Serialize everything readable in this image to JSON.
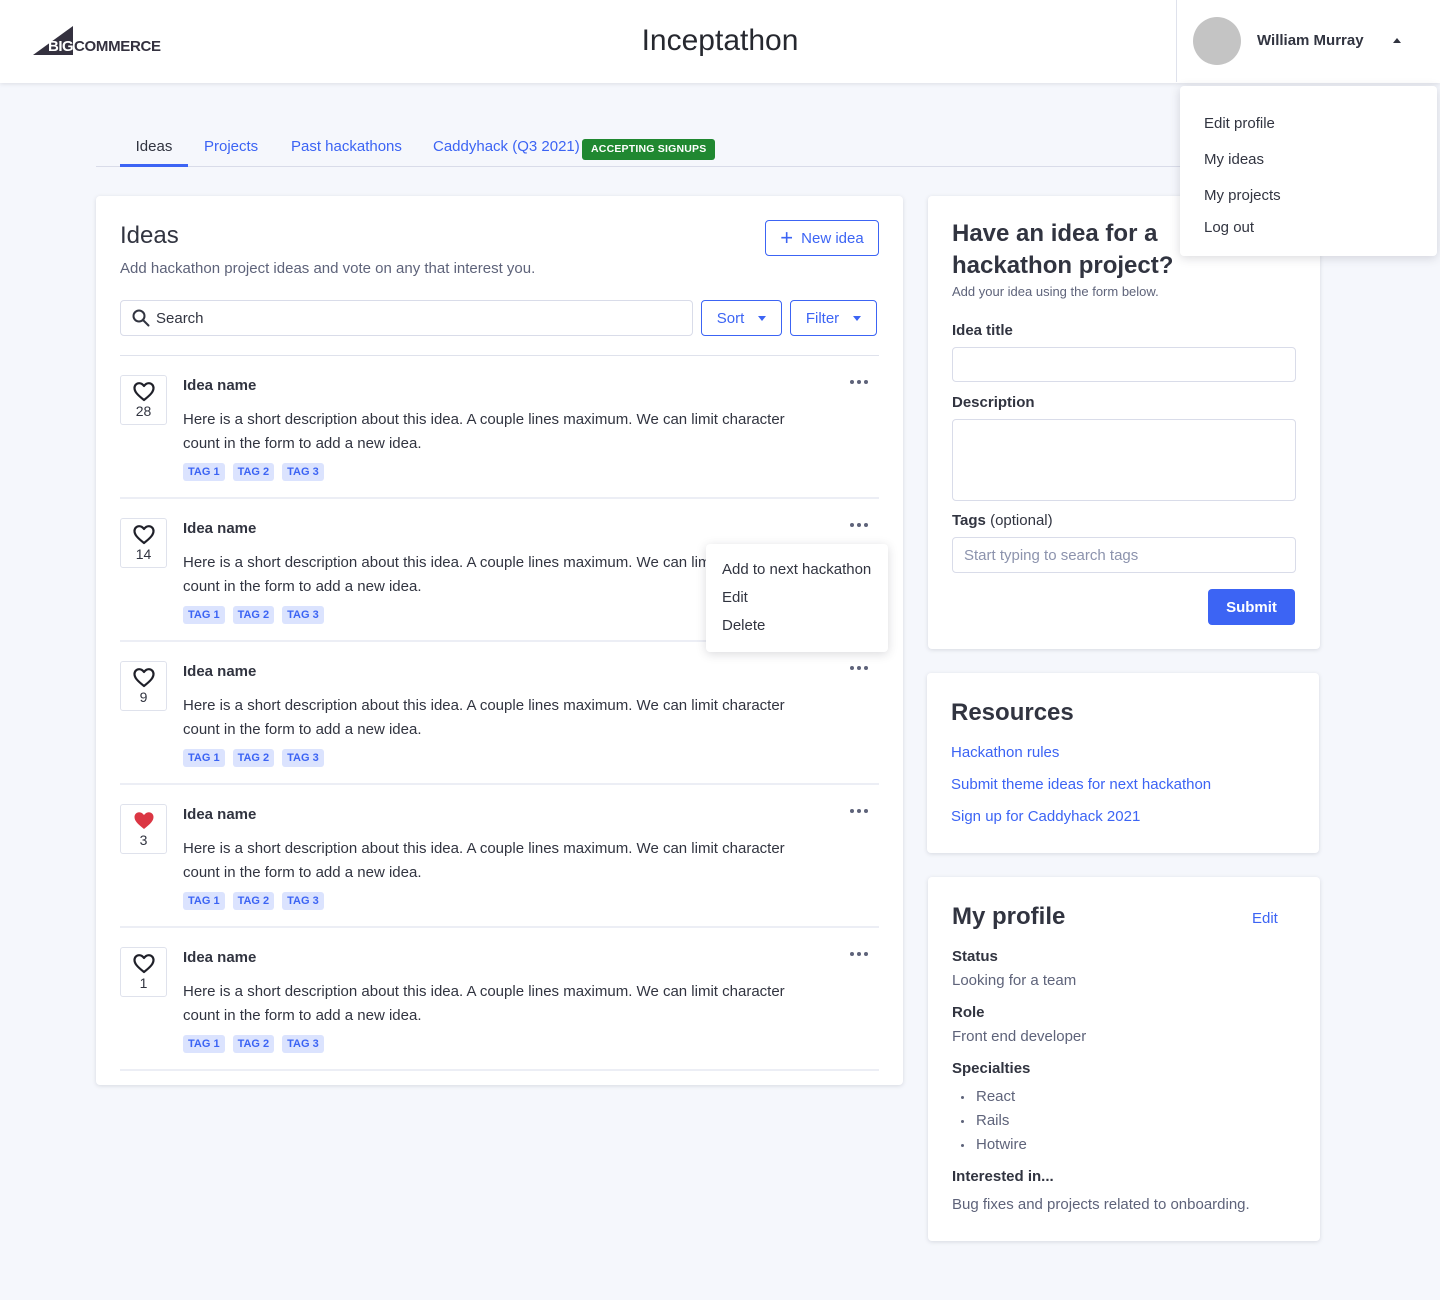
{
  "header": {
    "logo": {
      "big": "BIG",
      "commerce": "COMMERCE"
    },
    "title": "Inceptathon",
    "user": {
      "name": "William Murray",
      "avatar_color": "#c4c4c4"
    }
  },
  "user_menu": {
    "items": [
      "Edit profile",
      "My ideas",
      "My projects",
      "Log out"
    ]
  },
  "tabs": {
    "items": [
      {
        "label": "Ideas",
        "active": true
      },
      {
        "label": "Projects",
        "active": false
      },
      {
        "label": "Past hackathons",
        "active": false
      },
      {
        "label": "Caddyhack (Q3 2021)",
        "active": false
      }
    ],
    "badge": "ACCEPTING SIGNUPS",
    "badge_color": "#208831"
  },
  "ideas": {
    "title": "Ideas",
    "subtitle": "Add hackathon project ideas and vote on any that interest you.",
    "new_idea_label": "New idea",
    "search_placeholder": "Search",
    "sort_label": "Sort",
    "filter_label": "Filter",
    "list": [
      {
        "name": "Idea name",
        "description": "Here is a short description about this idea. A couple lines maximum. We can limit character count in the form to add a new idea.",
        "votes": "28",
        "liked": false,
        "tags": [
          "TAG 1",
          "TAG 2",
          "TAG 3"
        ]
      },
      {
        "name": "Idea name",
        "description": "Here is a short description about this idea. A couple lines maximum. We can limit character count in the form to add a new idea.",
        "votes": "14",
        "liked": false,
        "tags": [
          "TAG 1",
          "TAG 2",
          "TAG 3"
        ]
      },
      {
        "name": "Idea name",
        "description": "Here is a short description about this idea. A couple lines maximum. We can limit character count in the form to add a new idea.",
        "votes": "9",
        "liked": false,
        "tags": [
          "TAG 1",
          "TAG 2",
          "TAG 3"
        ]
      },
      {
        "name": "Idea name",
        "description": "Here is a short description about this idea. A couple lines maximum. We can limit character count in the form to add a new idea.",
        "votes": "3",
        "liked": true,
        "tags": [
          "TAG 1",
          "TAG 2",
          "TAG 3"
        ]
      },
      {
        "name": "Idea name",
        "description": "Here is a short description about this idea. A couple lines maximum. We can limit character count in the form to add a new idea.",
        "votes": "1",
        "liked": false,
        "tags": [
          "TAG 1",
          "TAG 2",
          "TAG 3"
        ]
      }
    ],
    "item_menu": [
      "Add to next hackathon",
      "Edit",
      "Delete"
    ]
  },
  "idea_form": {
    "title": "Have an idea for a hackathon project?",
    "subtitle": "Add your idea using the form below.",
    "title_label": "Idea title",
    "title_value": "",
    "description_label": "Description",
    "description_value": "",
    "tags_label": "Tags",
    "tags_optional": "(optional)",
    "tags_placeholder": "Start typing to search tags",
    "submit_label": "Submit"
  },
  "resources": {
    "title": "Resources",
    "links": [
      "Hackathon rules",
      "Submit theme ideas for next hackathon",
      "Sign up for Caddyhack 2021"
    ]
  },
  "profile": {
    "title": "My profile",
    "edit_label": "Edit",
    "status_label": "Status",
    "status_value": "Looking for a team",
    "role_label": "Role",
    "role_value": "Front end developer",
    "specialties_label": "Specialties",
    "specialties": [
      "React",
      "Rails",
      "Hotwire"
    ],
    "interested_label": "Interested in...",
    "interested_value": "Bug fixes and projects related to onboarding."
  },
  "colors": {
    "primary": "#3c64f4",
    "heart_liked": "#db3643",
    "tag_bg": "#dbe3fe"
  }
}
